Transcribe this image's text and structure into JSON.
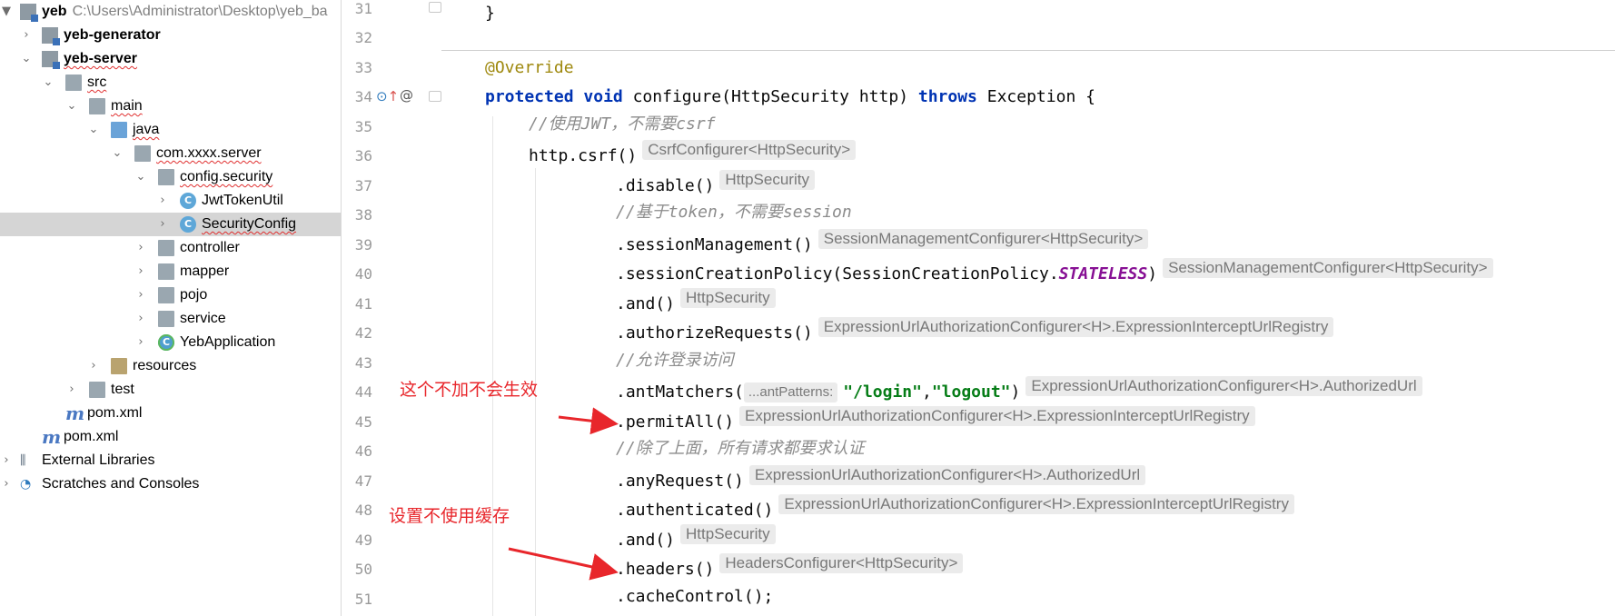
{
  "project_tree": {
    "root": {
      "name": "yeb",
      "path": "C:\\Users\\Administrator\\Desktop\\yeb_ba"
    },
    "items": [
      {
        "label": "yeb-generator"
      },
      {
        "label": "yeb-server"
      },
      {
        "label": "src"
      },
      {
        "label": "main"
      },
      {
        "label": "java"
      },
      {
        "label": "com.xxxx.server"
      },
      {
        "label": "config.security"
      },
      {
        "label": "JwtTokenUtil"
      },
      {
        "label": "SecurityConfig"
      },
      {
        "label": "controller"
      },
      {
        "label": "mapper"
      },
      {
        "label": "pojo"
      },
      {
        "label": "service"
      },
      {
        "label": "YebApplication"
      },
      {
        "label": "resources"
      },
      {
        "label": "test"
      },
      {
        "label": "pom.xml"
      },
      {
        "label": "pom.xml"
      },
      {
        "label": "External Libraries"
      },
      {
        "label": "Scratches and Consoles"
      }
    ],
    "selected": "SecurityConfig"
  },
  "editor": {
    "line_numbers": [
      "31",
      "32",
      "33",
      "34",
      "35",
      "36",
      "37",
      "38",
      "39",
      "40",
      "41",
      "42",
      "43",
      "44",
      "45",
      "46",
      "47",
      "48",
      "49",
      "50",
      "51"
    ],
    "lines": {
      "l31": {
        "brace": "}"
      },
      "l33": {
        "annotation": "@Override"
      },
      "l34": {
        "kw1": "protected",
        "kw2": "void",
        "method": "configure(HttpSecurity http)",
        "kw3": "throws",
        "rest": "Exception {"
      },
      "l35": {
        "comment": "//使用JWT，不需要csrf"
      },
      "l36": {
        "code": "http.csrf()",
        "hint": "CsrfConfigurer<HttpSecurity>"
      },
      "l37": {
        "code": ".disable()",
        "hint": "HttpSecurity"
      },
      "l38": {
        "comment": "//基于token，不需要session"
      },
      "l39": {
        "code": ".sessionManagement()",
        "hint": "SessionManagementConfigurer<HttpSecurity>"
      },
      "l40": {
        "code": ".sessionCreationPolicy(SessionCreationPolicy.",
        "static": "STATELESS",
        "close": ")",
        "hint": "SessionManagementConfigurer<HttpSecurity>"
      },
      "l41": {
        "code": ".and()",
        "hint": "HttpSecurity"
      },
      "l42": {
        "code": ".authorizeRequests()",
        "hint": "ExpressionUrlAuthorizationConfigurer<H>.ExpressionInterceptUrlRegistry"
      },
      "l43": {
        "comment": "//允许登录访问"
      },
      "l44": {
        "code": ".antMatchers(",
        "param_hint": "...antPatterns:",
        "str1": "\"/login\"",
        "comma": ",",
        "str2": "\"logout\"",
        "close": ")",
        "hint": "ExpressionUrlAuthorizationConfigurer<H>.AuthorizedUrl"
      },
      "l45": {
        "code": ".permitAll()",
        "hint": "ExpressionUrlAuthorizationConfigurer<H>.ExpressionInterceptUrlRegistry"
      },
      "l46": {
        "comment": "//除了上面，所有请求都要求认证"
      },
      "l47": {
        "code": ".anyRequest()",
        "hint": "ExpressionUrlAuthorizationConfigurer<H>.AuthorizedUrl"
      },
      "l48": {
        "code": ".authenticated()",
        "hint": "ExpressionUrlAuthorizationConfigurer<H>.ExpressionInterceptUrlRegistry"
      },
      "l49": {
        "code": ".and()",
        "hint": "HttpSecurity"
      },
      "l50": {
        "code": ".headers()",
        "hint": "HeadersConfigurer<HttpSecurity>"
      },
      "l51": {
        "code": ".cacheControl();"
      }
    }
  },
  "annotations": {
    "note1": "这个不加不会生效",
    "note2": "设置不使用缓存",
    "color": "#e8262b"
  },
  "icons": [
    "module-icon",
    "folder-icon",
    "source-folder-icon",
    "package-icon",
    "class-icon",
    "spring-class-icon",
    "maven-icon",
    "libraries-icon",
    "scratches-icon",
    "override-gutter-icon",
    "at-gutter-icon"
  ]
}
